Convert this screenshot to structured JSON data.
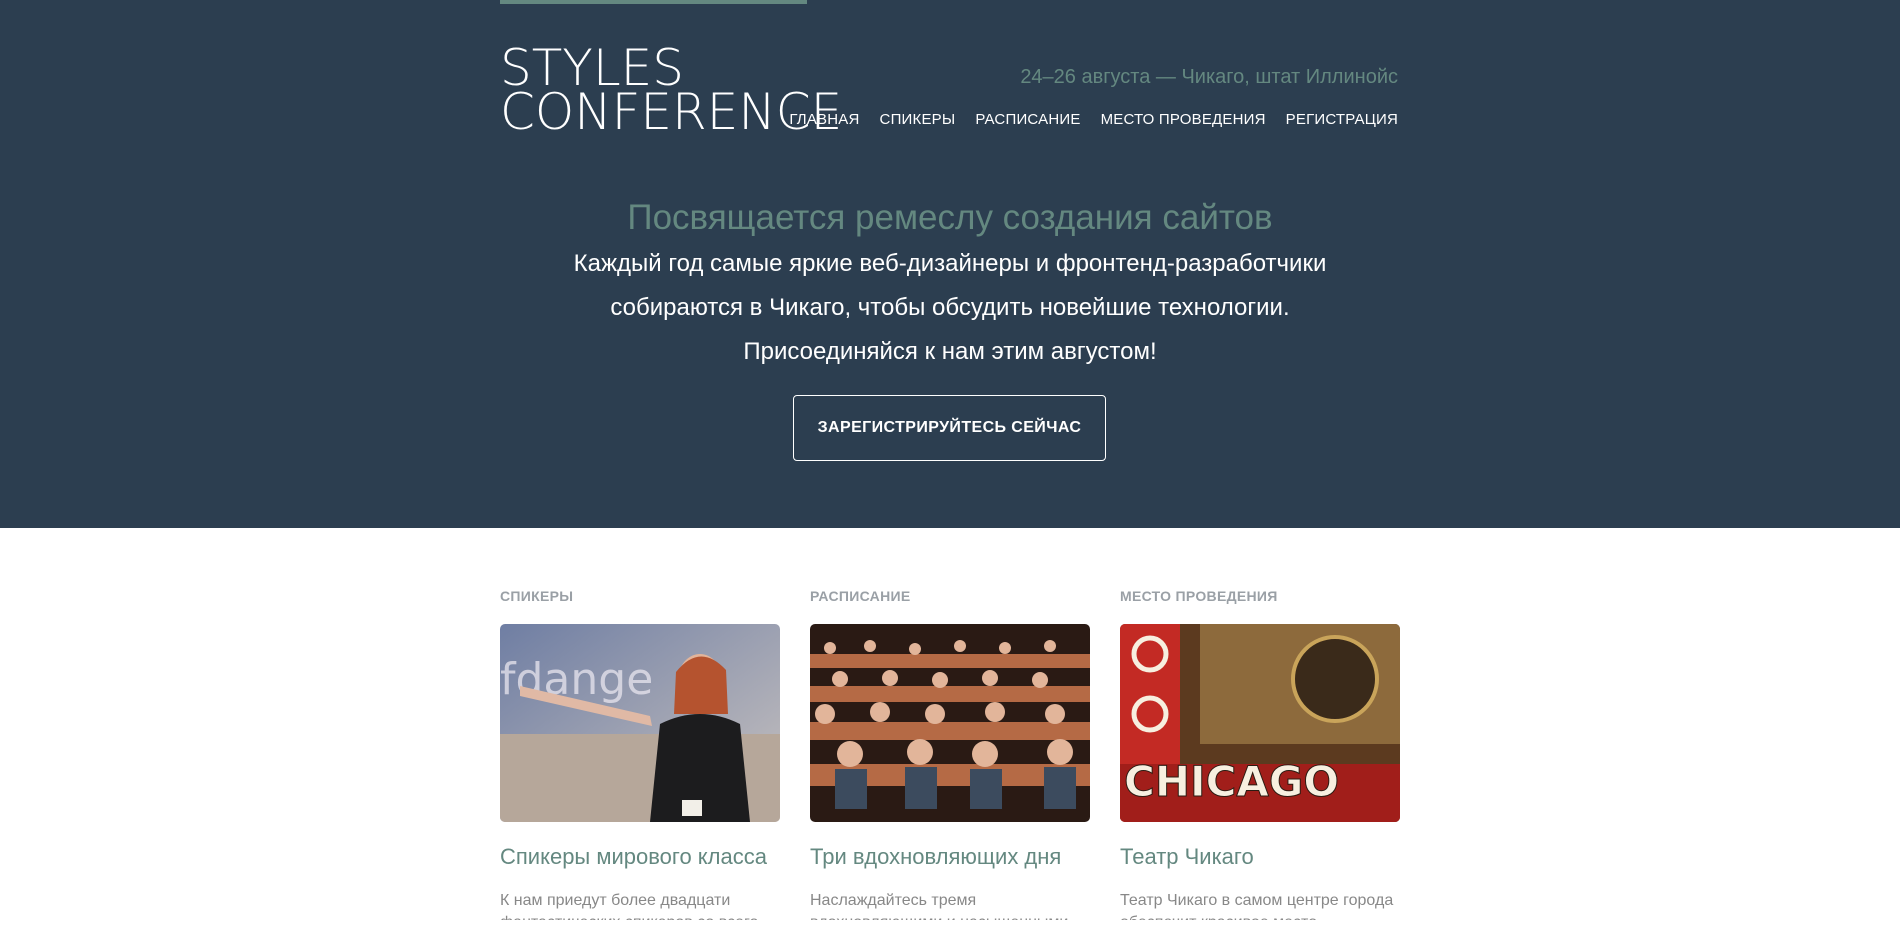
{
  "header": {
    "logo_line1": "STYLES",
    "logo_line2": "CONFERENCE",
    "date_location": "24–26 августа — Чикаго, штат Иллинойс",
    "nav": [
      "ГЛАВНАЯ",
      "СПИКЕРЫ",
      "РАСПИСАНИЕ",
      "МЕСТО ПРОВЕДЕНИЯ",
      "РЕГИСТРАЦИЯ"
    ]
  },
  "hero": {
    "title": "Посвящается ремеслу создания сайтов",
    "lead_line1": "Каждый год самые яркие веб-дизайнеры и фронтенд-разработчики",
    "lead_line2": "собираются в Чикаго, чтобы обсудить новейшие технологии.",
    "lead_line3": "Присоединяйся к нам этим августом!",
    "cta": "ЗАРЕГИСТРИРУЙТЕСЬ СЕЙЧАС"
  },
  "teasers": [
    {
      "label": "СПИКЕРЫ",
      "heading": "Спикеры мирового класса",
      "text": "К нам приедут более двадцати фантастических спикеров со всего"
    },
    {
      "label": "РАСПИСАНИЕ",
      "heading": "Три вдохновляющих дня",
      "text": "Наслаждайтесь тремя вдохновляющими и насыщенными"
    },
    {
      "label": "МЕСТО ПРОВЕДЕНИЯ",
      "heading": "Театр Чикаго",
      "text": "Театр Чикаго в самом центре города обеспечит красивое место"
    }
  ],
  "image_text": {
    "speaker_screen": "fdange",
    "venue_sign": "CHICAGO"
  },
  "colors": {
    "hero_bg": "#2c3e50",
    "accent": "#648880",
    "white": "#ffffff",
    "muted": "#888888"
  }
}
